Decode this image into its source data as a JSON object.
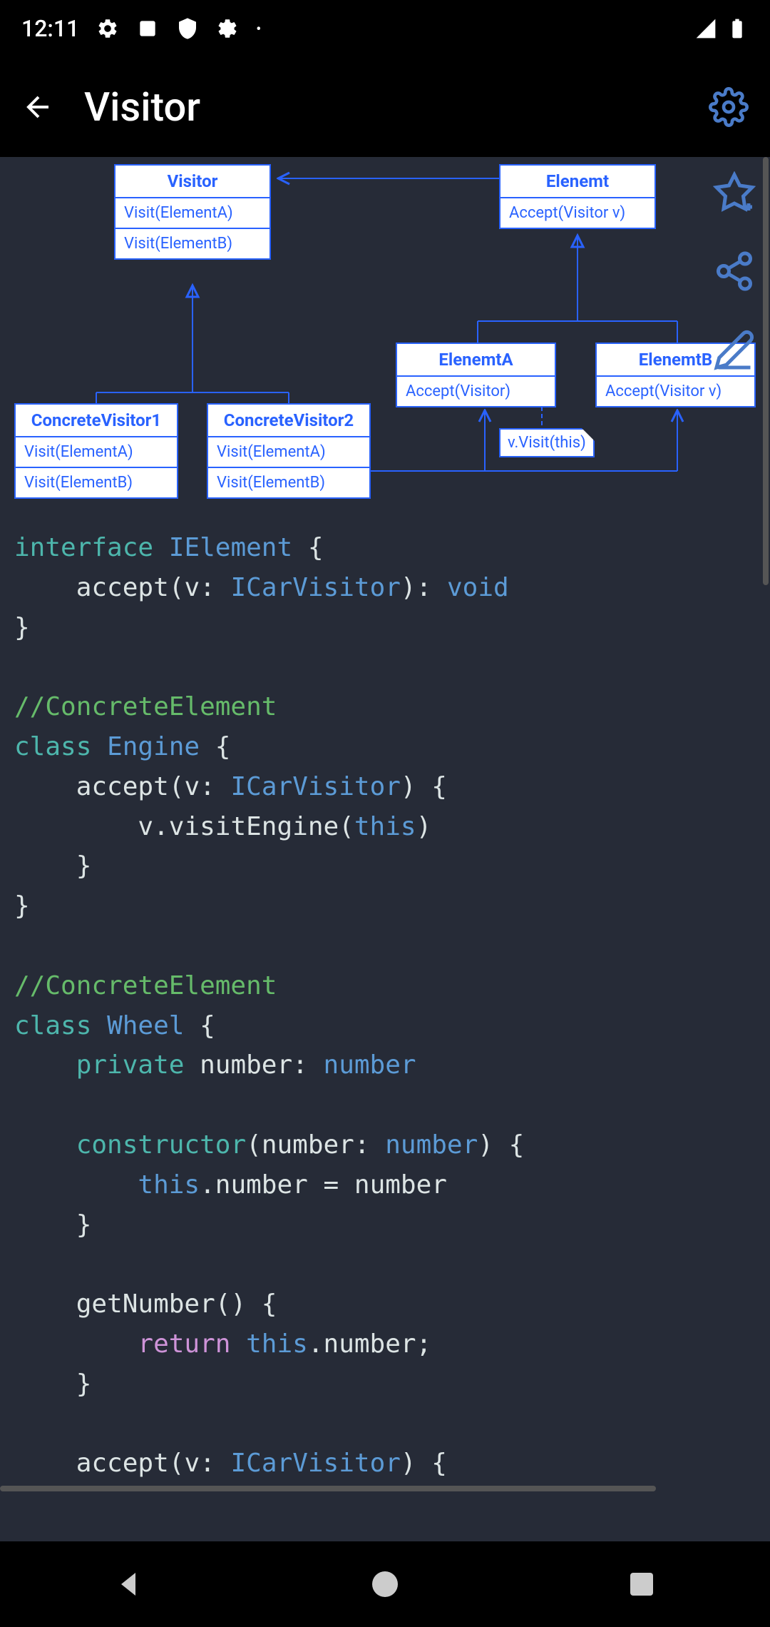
{
  "status": {
    "time": "12:11"
  },
  "header": {
    "title": "Visitor"
  },
  "diagram": {
    "visitor": {
      "name": "Visitor",
      "m1": "Visit(ElementA)",
      "m2": "Visit(ElementB)"
    },
    "element": {
      "name": "Elenemt",
      "m1": "Accept(Visitor v)"
    },
    "cv1": {
      "name": "ConcreteVisitor1",
      "m1": "Visit(ElementA)",
      "m2": "Visit(ElementB)"
    },
    "cv2": {
      "name": "ConcreteVisitor2",
      "m1": "Visit(ElementA)",
      "m2": "Visit(ElementB)"
    },
    "ea": {
      "name": "ElenemtA",
      "m1": "Accept(Visitor)"
    },
    "eb": {
      "name": "ElenemtB",
      "m1": "Accept(Visitor v)"
    },
    "note": "v.Visit(this)"
  },
  "code": {
    "interface_kw": "interface",
    "ielement": "IElement",
    "accept": "accept",
    "v": "v",
    "icarvisitor": "ICarVisitor",
    "void": "void",
    "comment_ce": "//ConcreteElement",
    "class_kw": "class",
    "engine": "Engine",
    "visitengine": "visitEngine",
    "this": "this",
    "wheel": "Wheel",
    "private": "private",
    "number_kw": "number",
    "number_type": "number",
    "constructor": "constructor",
    "getnumber": "getNumber",
    "return": "return"
  }
}
